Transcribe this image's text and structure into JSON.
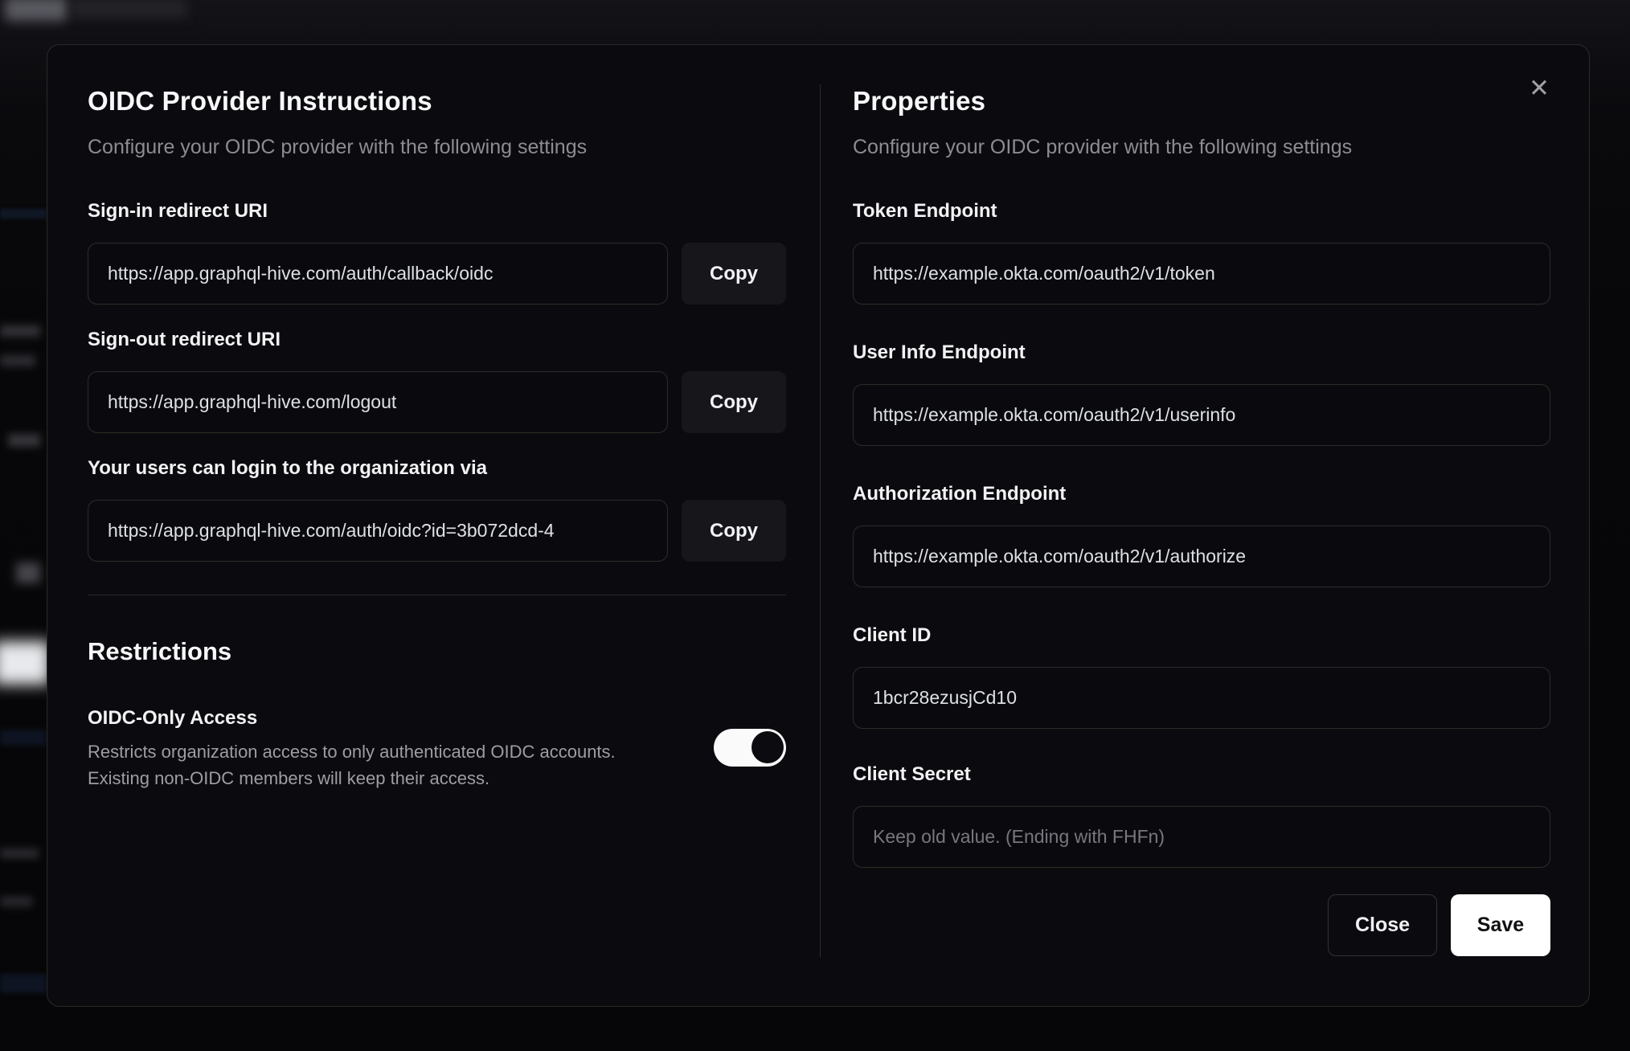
{
  "modal": {
    "close_icon": "✕",
    "left": {
      "title": "OIDC Provider Instructions",
      "subtitle": "Configure your OIDC provider with the following settings",
      "fields": [
        {
          "label": "Sign-in redirect URI",
          "value": "https://app.graphql-hive.com/auth/callback/oidc",
          "copy_label": "Copy"
        },
        {
          "label": "Sign-out redirect URI",
          "value": "https://app.graphql-hive.com/logout",
          "copy_label": "Copy"
        },
        {
          "label": "Your users can login to the organization via",
          "value": "https://app.graphql-hive.com/auth/oidc?id=3b072dcd-4",
          "copy_label": "Copy"
        }
      ],
      "restrictions": {
        "title": "Restrictions",
        "toggle_label": "OIDC-Only Access",
        "toggle_description": "Restricts organization access to only authenticated OIDC accounts. Existing non-OIDC members will keep their access.",
        "toggle_state": "on"
      }
    },
    "right": {
      "title": "Properties",
      "subtitle": "Configure your OIDC provider with the following settings",
      "fields": [
        {
          "label": "Token Endpoint",
          "value": "https://example.okta.com/oauth2/v1/token"
        },
        {
          "label": "User Info Endpoint",
          "value": "https://example.okta.com/oauth2/v1/userinfo"
        },
        {
          "label": "Authorization Endpoint",
          "value": "https://example.okta.com/oauth2/v1/authorize"
        },
        {
          "label": "Client ID",
          "value": "1bcr28ezusjCd10"
        },
        {
          "label": "Client Secret",
          "value": "",
          "placeholder": "Keep old value. (Ending with FHFn)"
        }
      ],
      "buttons": {
        "close": "Close",
        "save": "Save"
      }
    }
  },
  "colors": {
    "modal_background": "#0b0b0f",
    "input_border": "#2e2b27",
    "copy_button_background": "#17171b",
    "save_button_background": "#ffffff",
    "toggle_on_track": "#fafafa",
    "subtitle_text": "#8c8c92"
  }
}
